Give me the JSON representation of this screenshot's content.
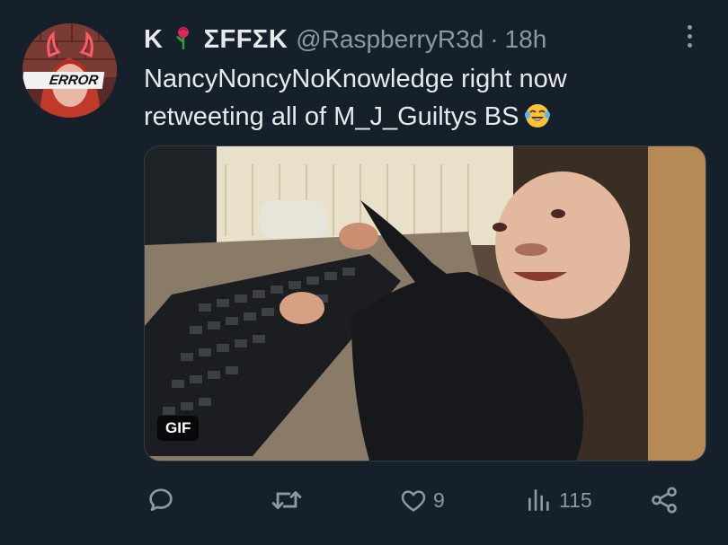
{
  "tweet": {
    "display_name_prefix": "K",
    "display_name_suffix": "ΣFFΣK",
    "handle": "@RaspberryR3d",
    "separator": "·",
    "time": "18h",
    "text_line1": "NancyNoncyNoKnowledge right now",
    "text_line2": "retweeting all of M_J_Guiltys BS",
    "avatar_label": "ERROR"
  },
  "media": {
    "badge": "GIF"
  },
  "actions": {
    "reply_count": "",
    "retweet_count": "",
    "like_count": "9",
    "views_count": "115"
  },
  "icons": {
    "rose": "rose-icon",
    "emoji": "face-with-tears-of-joy-icon",
    "more": "more-options-icon",
    "reply": "reply-icon",
    "retweet": "retweet-icon",
    "like": "heart-icon",
    "views": "views-chart-icon",
    "share": "share-icon"
  },
  "colors": {
    "background": "#15202b",
    "text_primary": "#e7e9ea",
    "text_secondary": "#8b98a5"
  }
}
